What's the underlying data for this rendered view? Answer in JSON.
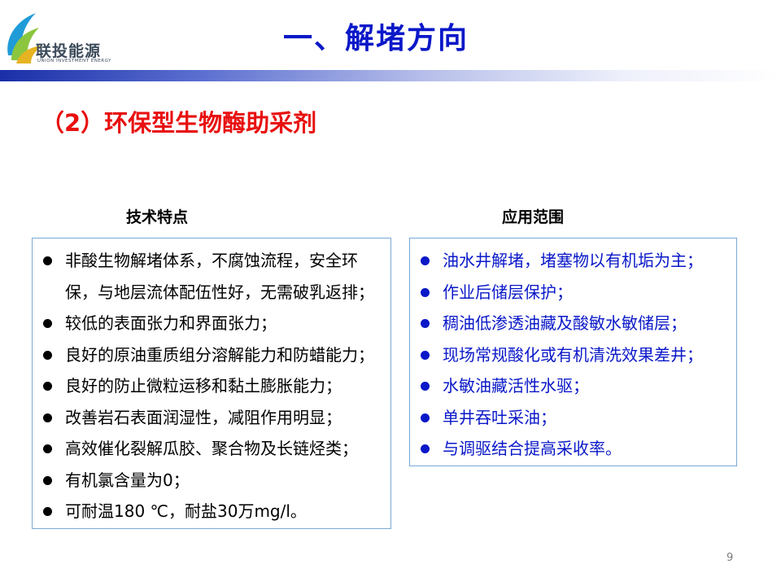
{
  "logo": {
    "name_cn": "联投能源",
    "name_en": "UNION INVESTMENT ENERGY"
  },
  "header": {
    "title": "一、解堵方向"
  },
  "section": {
    "title": "（2）环保型生物酶助采剂"
  },
  "left_column": {
    "heading": "技术特点",
    "items": [
      "非酸生物解堵体系，不腐蚀流程，安全环保，与地层流体配伍性好，无需破乳返排；",
      "较低的表面张力和界面张力；",
      "良好的原油重质组分溶解能力和防蜡能力；",
      "良好的防止微粒运移和黏土膨胀能力；",
      "改善岩石表面润湿性，减阻作用明显；",
      "高效催化裂解瓜胶、聚合物及长链烃类；",
      "有机氯含量为0；",
      "可耐温180 ℃，耐盐30万mg/l。"
    ]
  },
  "right_column": {
    "heading": "应用范围",
    "items": [
      "油水井解堵，堵塞物以有机垢为主；",
      "作业后储层保护；",
      "稠油低渗透油藏及酸敏水敏储层；",
      "现场常规酸化或有机清洗效果差井；",
      "水敏油藏活性水驱；",
      "单井吞吐采油；",
      "与调驱结合提高采收率。"
    ]
  },
  "footer": {
    "page_number": "9"
  },
  "colors": {
    "title_blue": "#0a18c8",
    "section_red": "#e81010",
    "box_border": "#7aaad6",
    "logo_blue": "#1f9bd8",
    "logo_green": "#8cc63f",
    "logo_gold": "#e6b422"
  },
  "icons": {
    "logo_mark": "leaf-swoosh-logo"
  }
}
